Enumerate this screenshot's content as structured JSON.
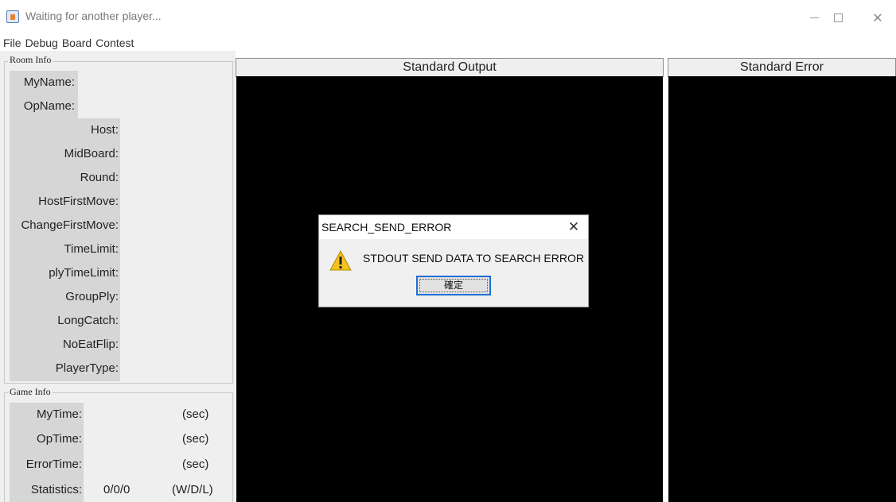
{
  "window": {
    "title": "Waiting for another player...",
    "min_icon": "minimize-icon",
    "max_icon": "maximize-icon",
    "close_icon": "close-icon"
  },
  "menu": [
    "File",
    "Debug",
    "Board",
    "Contest"
  ],
  "room_info": {
    "label": "Room Info",
    "fields": [
      "MyName:",
      "OpName:",
      "Host:",
      "MidBoard:",
      "Round:",
      "HostFirstMove:",
      "ChangeFirstMove:",
      "TimeLimit:",
      "plyTimeLimit:",
      "GroupPly:",
      "LongCatch:",
      "NoEatFlip:",
      "PlayerType:"
    ]
  },
  "game_info": {
    "label": "Game Info",
    "rows": [
      {
        "label": "MyTime:",
        "value": "",
        "unit": "(sec)"
      },
      {
        "label": "OpTime:",
        "value": "",
        "unit": "(sec)"
      },
      {
        "label": "ErrorTime:",
        "value": "",
        "unit": "(sec)"
      },
      {
        "label": "Statistics:",
        "value": "0/0/0",
        "unit": "(W/D/L)"
      }
    ]
  },
  "panels": {
    "stdout": "Standard Output",
    "stderr": "Standard Error"
  },
  "dialog": {
    "title": "SEARCH_SEND_ERROR",
    "message": "STDOUT SEND DATA TO SEARCH ERROR",
    "ok_label": "確定",
    "icon": "warning-icon"
  },
  "colors": {
    "console_bg": "#000000",
    "focus_border": "#1f6fd6",
    "label_bg": "#d6d6d6"
  }
}
